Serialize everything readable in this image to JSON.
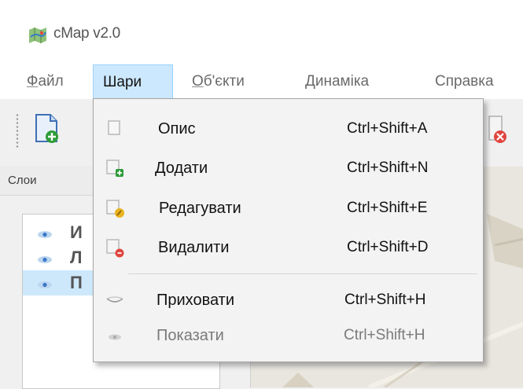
{
  "window": {
    "title": "cMap v2.0",
    "app_icon": "map-app-icon"
  },
  "menubar": {
    "items": [
      {
        "label": "Файл",
        "mnemonic": "Ф",
        "rest": "айл",
        "state": "normal"
      },
      {
        "label": "Шари",
        "state": "open"
      },
      {
        "label": "Об'єкти",
        "mnemonic": "О",
        "rest": "б'єкти",
        "state": "normal"
      },
      {
        "label": "Динаміка",
        "state": "normal"
      },
      {
        "label": "Справка",
        "state": "normal"
      }
    ]
  },
  "toolbar": {
    "buttons": [
      {
        "icon": "new-layer-icon"
      },
      {
        "icon": "delete-object-icon"
      }
    ]
  },
  "layers_panel": {
    "title": "Слои",
    "layers": [
      {
        "name": "И",
        "icon": "eye-icon",
        "selected": false
      },
      {
        "name": "Л",
        "icon": "eye-icon",
        "selected": false
      },
      {
        "name": "П",
        "icon": "eye-icon",
        "selected": true
      }
    ]
  },
  "dropdown": {
    "items": [
      {
        "label": "Опис",
        "shortcut": "Ctrl+Shift+A",
        "icon": "layer-description-icon",
        "enabled": true
      },
      {
        "label": "Додати",
        "shortcut": "Ctrl+Shift+N",
        "icon": "add-layer-icon",
        "enabled": true
      },
      {
        "label": "Редагувати",
        "shortcut": "Ctrl+Shift+E",
        "icon": "edit-layer-icon",
        "enabled": true
      },
      {
        "label": "Видалити",
        "shortcut": "Ctrl+Shift+D",
        "icon": "delete-layer-icon",
        "enabled": true
      },
      {
        "label": "Приховати",
        "shortcut": "Ctrl+Shift+H",
        "icon": "hide-layer-icon",
        "enabled": true
      },
      {
        "label": "Показати",
        "shortcut": "Ctrl+Shift+H",
        "icon": "show-layer-icon",
        "enabled": false
      }
    ]
  },
  "colors": {
    "menu_open_bg": "#cce8ff",
    "menu_open_border": "#99d1ff",
    "selection_bg": "#cde8fb",
    "add_badge": "#2e9c3a",
    "edit_badge": "#e8b320",
    "delete_badge": "#e0453f",
    "disabled_text": "#7a7a7a"
  }
}
